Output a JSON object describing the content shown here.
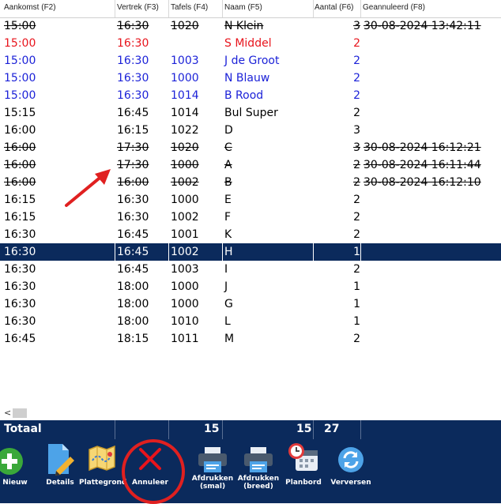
{
  "columns": {
    "aankomst": "Aankomst (F2)",
    "vertrek": "Vertrek (F3)",
    "tafels": "Tafels (F4)",
    "naam": "Naam (F5)",
    "aantal": "Aantal (F6)",
    "geannuleerd": "Geannuleerd (F8)"
  },
  "rows": [
    {
      "aankomst": "15:00",
      "vertrek": "16:30",
      "tafels": "1020",
      "naam": "N Klein",
      "aantal": "3",
      "geannuleerd": "30-08-2024 13:42:11",
      "style": "strike"
    },
    {
      "aankomst": "15:00",
      "vertrek": "16:30",
      "tafels": "",
      "naam": "S Middel",
      "aantal": "2",
      "geannuleerd": "",
      "style": "red"
    },
    {
      "aankomst": "15:00",
      "vertrek": "16:30",
      "tafels": "1003",
      "naam": "J de Groot",
      "aantal": "2",
      "geannuleerd": "",
      "style": "blue"
    },
    {
      "aankomst": "15:00",
      "vertrek": "16:30",
      "tafels": "1000",
      "naam": "N Blauw",
      "aantal": "2",
      "geannuleerd": "",
      "style": "blue"
    },
    {
      "aankomst": "15:00",
      "vertrek": "16:30",
      "tafels": "1014",
      "naam": "B Rood",
      "aantal": "2",
      "geannuleerd": "",
      "style": "blue"
    },
    {
      "aankomst": "15:15",
      "vertrek": "16:45",
      "tafels": "1014",
      "naam": "Bul Super",
      "aantal": "2",
      "geannuleerd": "",
      "style": "normal"
    },
    {
      "aankomst": "16:00",
      "vertrek": "16:15",
      "tafels": "1022",
      "naam": "D",
      "aantal": "3",
      "geannuleerd": "",
      "style": "normal"
    },
    {
      "aankomst": "16:00",
      "vertrek": "17:30",
      "tafels": "1020",
      "naam": "C",
      "aantal": "3",
      "geannuleerd": "30-08-2024 16:12:21",
      "style": "strike"
    },
    {
      "aankomst": "16:00",
      "vertrek": "17:30",
      "tafels": "1000",
      "naam": "A",
      "aantal": "2",
      "geannuleerd": "30-08-2024 16:11:44",
      "style": "strike"
    },
    {
      "aankomst": "16:00",
      "vertrek": "16:00",
      "tafels": "1002",
      "naam": "B",
      "aantal": "2",
      "geannuleerd": "30-08-2024 16:12:10",
      "style": "strike"
    },
    {
      "aankomst": "16:15",
      "vertrek": "16:30",
      "tafels": "1000",
      "naam": "E",
      "aantal": "2",
      "geannuleerd": "",
      "style": "normal"
    },
    {
      "aankomst": "16:15",
      "vertrek": "16:30",
      "tafels": "1002",
      "naam": "F",
      "aantal": "2",
      "geannuleerd": "",
      "style": "normal"
    },
    {
      "aankomst": "16:30",
      "vertrek": "16:45",
      "tafels": "1001",
      "naam": "K",
      "aantal": "2",
      "geannuleerd": "",
      "style": "normal"
    },
    {
      "aankomst": "16:30",
      "vertrek": "16:45",
      "tafels": "1002",
      "naam": "H",
      "aantal": "1",
      "geannuleerd": "",
      "style": "selected"
    },
    {
      "aankomst": "16:30",
      "vertrek": "16:45",
      "tafels": "1003",
      "naam": "I",
      "aantal": "2",
      "geannuleerd": "",
      "style": "normal"
    },
    {
      "aankomst": "16:30",
      "vertrek": "18:00",
      "tafels": "1000",
      "naam": "J",
      "aantal": "1",
      "geannuleerd": "",
      "style": "normal"
    },
    {
      "aankomst": "16:30",
      "vertrek": "18:00",
      "tafels": "1000",
      "naam": "G",
      "aantal": "1",
      "geannuleerd": "",
      "style": "normal"
    },
    {
      "aankomst": "16:30",
      "vertrek": "18:00",
      "tafels": "1010",
      "naam": "L",
      "aantal": "1",
      "geannuleerd": "",
      "style": "normal"
    },
    {
      "aankomst": "16:45",
      "vertrek": "18:15",
      "tafels": "1011",
      "naam": "M",
      "aantal": "2",
      "geannuleerd": "",
      "style": "normal"
    }
  ],
  "totals": {
    "label": "Totaal",
    "tafels": "15",
    "naam": "15",
    "aantal": "27"
  },
  "toolbar": {
    "nieuw": "Nieuw",
    "details": "Details",
    "plattegrond": "Plattegrond",
    "annuleer": "Annuleer",
    "afdrukken_smal_1": "Afdrukken",
    "afdrukken_smal_2": "(smal)",
    "afdrukken_breed_1": "Afdrukken",
    "afdrukken_breed_2": "(breed)",
    "planbord": "Planbord",
    "verversen": "Verversen"
  },
  "colors": {
    "red": "#e8141c",
    "blue": "#1c22d8",
    "selected_bg": "#0b2a5c",
    "annotation": "#e02020"
  },
  "icons": {
    "nieuw": "plus-icon",
    "details": "document-edit-icon",
    "plattegrond": "map-icon",
    "annuleer": "close-icon",
    "afdrukken": "printer-icon",
    "planbord": "calendar-clock-icon",
    "verversen": "refresh-icon"
  }
}
